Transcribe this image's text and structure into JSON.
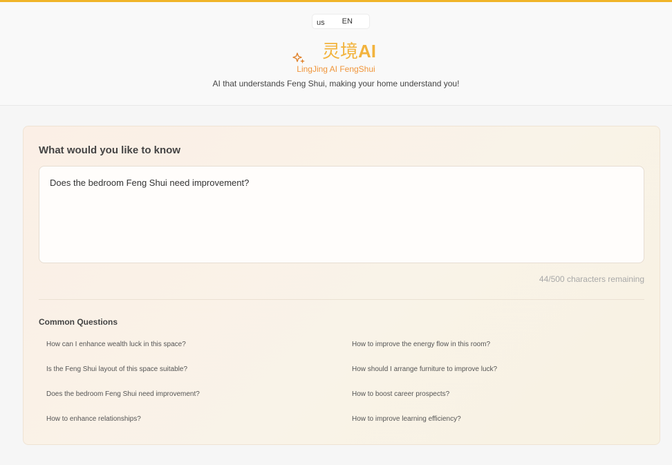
{
  "header": {
    "languages": [
      "us",
      "EN"
    ],
    "brand_cn": "灵境",
    "brand_ai": "AI",
    "brand_subtitle": "LingJing AI FengShui",
    "tagline": "AI that understands Feng Shui, making your home understand you!"
  },
  "colors": {
    "accent": "#f0b429",
    "brand": "#f2b33d",
    "subtitle": "#f0953a"
  },
  "form": {
    "title": "What would you like to know",
    "question_value": "Does the bedroom Feng Shui need improvement?",
    "char_count": "44/500 characters remaining"
  },
  "common": {
    "title": "Common Questions",
    "questions": [
      "How can I enhance wealth luck in this space?",
      "How to improve the energy flow in this room?",
      "Is the Feng Shui layout of this space suitable?",
      "How should I arrange furniture to improve luck?",
      "Does the bedroom Feng Shui need improvement?",
      "How to boost career prospects?",
      "How to enhance relationships?",
      "How to improve learning efficiency?"
    ]
  }
}
